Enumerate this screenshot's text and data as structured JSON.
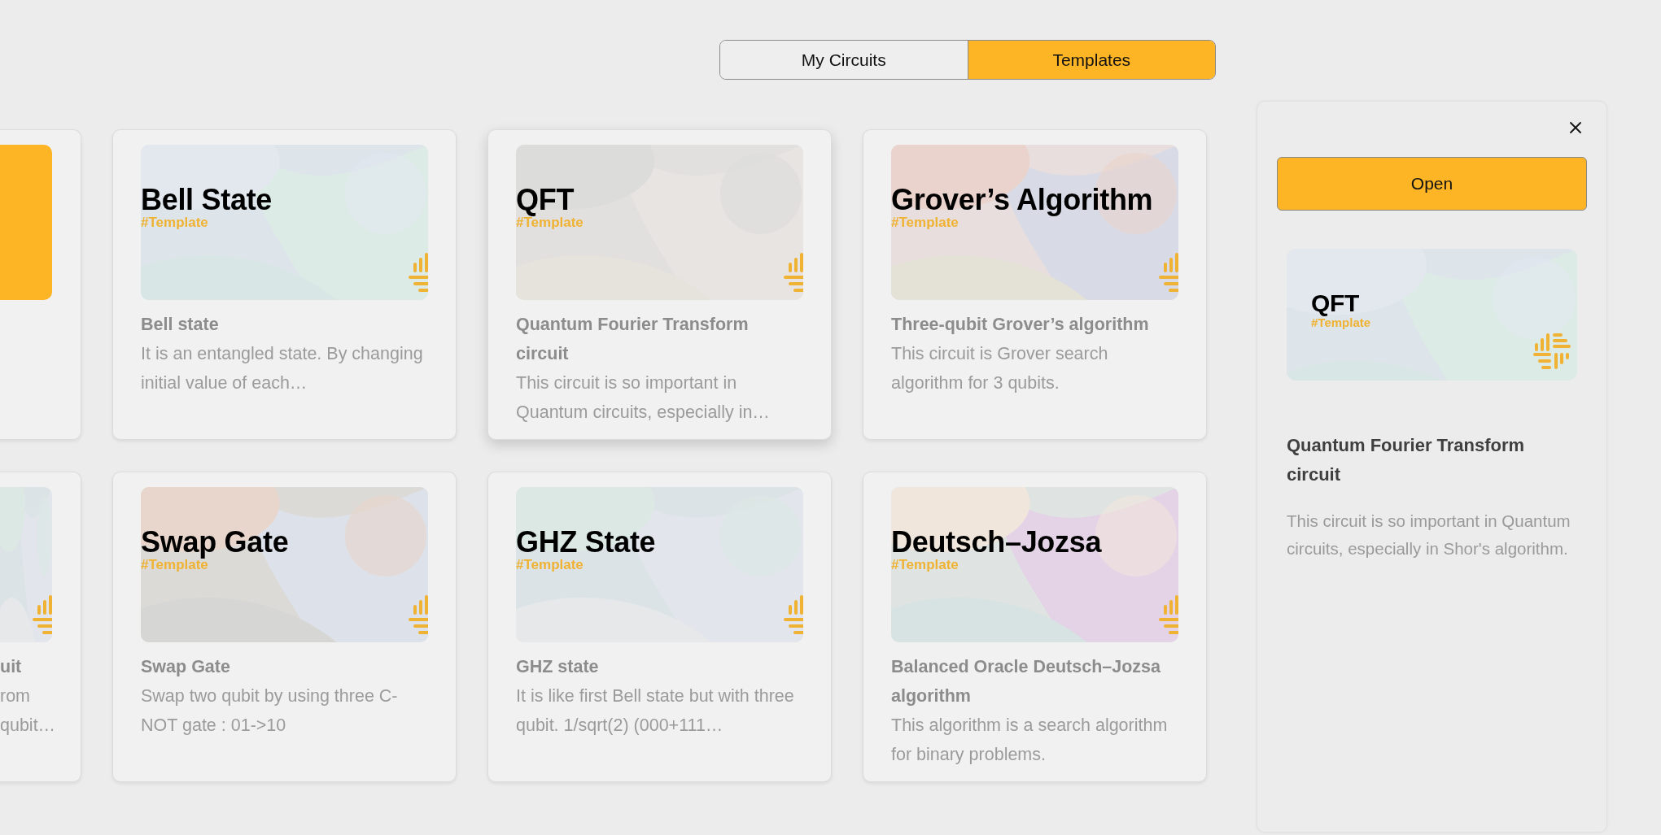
{
  "tabs": [
    {
      "label": "My Circuits",
      "selected": false
    },
    {
      "label": "Templates",
      "selected": true
    }
  ],
  "card_rows": [
    [
      {
        "kind": "cut",
        "thumbnail": {
          "kind": "solid"
        }
      },
      {
        "kind": "full",
        "selected": false,
        "thumbnail": {
          "heading": "Bell State",
          "tag": "#Template"
        },
        "title": "Bell state",
        "description": "It is an entangled state. By changing initial value of each…"
      },
      {
        "kind": "full",
        "selected": true,
        "thumbnail": {
          "heading": "QFT",
          "tag": "#Template"
        },
        "title": "Quantum Fourier Transform circuit",
        "description": "This circuit is so important in Quantum circuits, especially in…"
      },
      {
        "kind": "full",
        "selected": false,
        "thumbnail": {
          "heading": "Grover’s Algorithm",
          "tag": "#Template"
        },
        "title": "Three-qubit Grover’s algorithm",
        "description": "This circuit is Grover search algorithm for 3 qubits."
      }
    ],
    [
      {
        "kind": "cut",
        "thumbnail": {
          "kind": "artwork"
        },
        "title": "uit",
        "description": "rom\nqubit…"
      },
      {
        "kind": "full",
        "selected": false,
        "thumbnail": {
          "heading": "Swap Gate",
          "tag": "#Template"
        },
        "title": "Swap Gate",
        "description": "Swap two qubit by using three C-NOT gate : 01->10"
      },
      {
        "kind": "full",
        "selected": false,
        "thumbnail": {
          "heading": "GHZ State",
          "tag": "#Template"
        },
        "title": "GHZ state",
        "description": "It is like first Bell state but with three qubit. 1/sqrt(2) (000+111…"
      },
      {
        "kind": "full",
        "selected": false,
        "thumbnail": {
          "heading": "Deutsch–Jozsa",
          "tag": "#Template"
        },
        "title": "Balanced Oracle Deutsch–Jozsa algorithm",
        "description": "This algorithm is a search algorithm for binary problems."
      }
    ]
  ],
  "details_panel": {
    "open_button": "Open",
    "thumbnail": {
      "heading": "QFT",
      "tag": "#Template"
    },
    "title": "Quantum Fourier Transform circuit",
    "description": "This circuit is so important in Quantum circuits, especially in Shor's algorithm."
  }
}
